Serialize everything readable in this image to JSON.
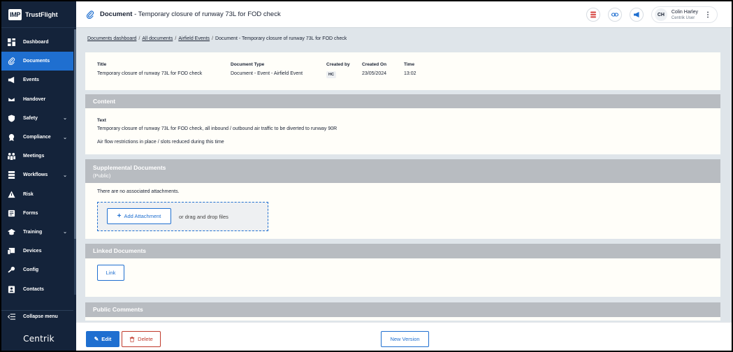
{
  "brand": {
    "logo": "IMP",
    "name": "TrustFlight",
    "footer": "Centrik"
  },
  "sidebar": {
    "items": [
      {
        "label": "Dashboard",
        "icon": "dashboard-icon",
        "active": false,
        "has_children": false
      },
      {
        "label": "Documents",
        "icon": "paperclip-icon",
        "active": true,
        "has_children": false
      },
      {
        "label": "Events",
        "icon": "megaphone-icon",
        "active": false,
        "has_children": false
      },
      {
        "label": "Handover",
        "icon": "handover-icon",
        "active": false,
        "has_children": false
      },
      {
        "label": "Safety",
        "icon": "shield-icon",
        "active": false,
        "has_children": true
      },
      {
        "label": "Compliance",
        "icon": "badge-icon",
        "active": false,
        "has_children": true
      },
      {
        "label": "Meetings",
        "icon": "meetings-icon",
        "active": false,
        "has_children": false
      },
      {
        "label": "Workflows",
        "icon": "workflow-icon",
        "active": false,
        "has_children": true
      },
      {
        "label": "Risk",
        "icon": "warning-icon",
        "active": false,
        "has_children": false
      },
      {
        "label": "Forms",
        "icon": "forms-icon",
        "active": false,
        "has_children": false
      },
      {
        "label": "Training",
        "icon": "graduation-cap-icon",
        "active": false,
        "has_children": true
      },
      {
        "label": "Devices",
        "icon": "devices-icon",
        "active": false,
        "has_children": false
      },
      {
        "label": "Config",
        "icon": "config-icon",
        "active": false,
        "has_children": false
      },
      {
        "label": "Contacts",
        "icon": "contacts-icon",
        "active": false,
        "has_children": false
      }
    ],
    "collapse_label": "Collapse menu"
  },
  "header": {
    "title_prefix": "Document",
    "title_sep": "-",
    "title": "Temporary closure of runway 73L for FOD check",
    "user": {
      "initials": "CH",
      "name": "Colin Harley",
      "role": "Centrik User"
    }
  },
  "breadcrumb": {
    "items": [
      "Documents dashboard",
      "All documents",
      "Airfield Events"
    ],
    "current": "Document - Temporary closure of runway 73L for FOD check"
  },
  "info": {
    "title_label": "Title",
    "title_value": "Temporary closure of runway 73L for FOD check",
    "type_label": "Document Type",
    "type_value": "Document - Event - Airfield Event",
    "created_by_label": "Created by",
    "created_by_value": "HC",
    "created_on_label": "Created On",
    "created_on_value": "23/05/2024",
    "time_label": "Time",
    "time_value": "13:02"
  },
  "content": {
    "heading": "Content",
    "text_label": "Text",
    "line1": "Temporary closure of runway 73L for FOD check, all inbound / outbound air traffic to be diverted to runway 90R",
    "line2": "Air flow restrictions in place / slots reduced during this time"
  },
  "supplemental": {
    "heading": "Supplemental Documents",
    "subheading": "(Public)",
    "empty_text": "There are no associated attachments.",
    "add_label": "Add Attachment",
    "drag_text": "or drag and drop files"
  },
  "linked": {
    "heading": "Linked Documents",
    "link_label": "Link"
  },
  "comments": {
    "heading": "Public Comments"
  },
  "footer": {
    "edit_label": "Edit",
    "delete_label": "Delete",
    "new_version_label": "New Version"
  },
  "colors": {
    "sidebar_bg": "#14233a",
    "accent": "#1f6fd0",
    "danger": "#c0392b",
    "section_header": "#b8bcc1",
    "page_bg": "#dfe5ea"
  }
}
